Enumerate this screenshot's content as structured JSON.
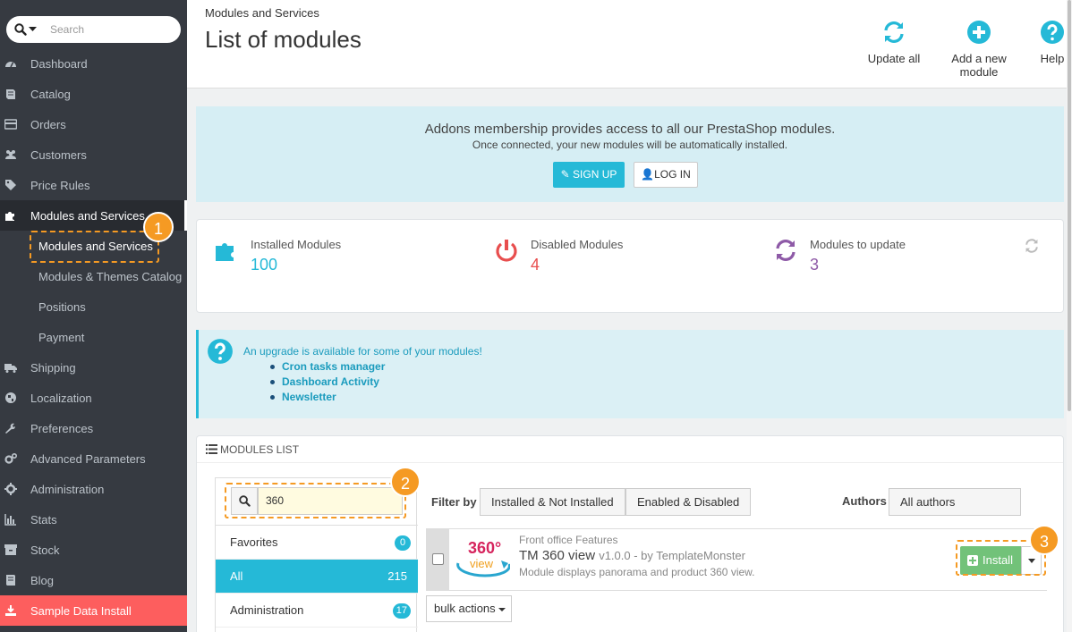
{
  "search": {
    "placeholder": "Search"
  },
  "nav": {
    "items": [
      {
        "label": "Dashboard",
        "icon": "dashboard-icon"
      },
      {
        "label": "Catalog",
        "icon": "book-icon"
      },
      {
        "label": "Orders",
        "icon": "credit-card-icon"
      },
      {
        "label": "Customers",
        "icon": "users-icon"
      },
      {
        "label": "Price Rules",
        "icon": "tags-icon"
      },
      {
        "label": "Modules and Services",
        "icon": "puzzle-icon"
      },
      {
        "label": "Shipping",
        "icon": "truck-icon"
      },
      {
        "label": "Localization",
        "icon": "globe-icon"
      },
      {
        "label": "Preferences",
        "icon": "wrench-icon"
      },
      {
        "label": "Advanced Parameters",
        "icon": "cogs-icon"
      },
      {
        "label": "Administration",
        "icon": "cog-icon"
      },
      {
        "label": "Stats",
        "icon": "bar-chart-icon"
      },
      {
        "label": "Stock",
        "icon": "archive-icon"
      },
      {
        "label": "Blog",
        "icon": "book-icon"
      },
      {
        "label": "Sample Data Install",
        "icon": "download-icon"
      }
    ],
    "submenu": [
      "Modules and Services",
      "Modules & Themes Catalog",
      "Positions",
      "Payment"
    ]
  },
  "callouts": [
    "1",
    "2",
    "3"
  ],
  "header": {
    "breadcrumb": "Modules and Services",
    "title": "List of modules",
    "toolbar": [
      {
        "label": "Update all",
        "icon": "refresh-icon"
      },
      {
        "label": "Add a new module",
        "icon": "plus-circle-icon"
      },
      {
        "label": "Help",
        "icon": "question-circle-icon"
      }
    ]
  },
  "addons": {
    "title": "Addons membership provides access to all our PrestaShop modules.",
    "subtitle": "Once connected, your new modules will be automatically installed.",
    "signup": "SIGN UP",
    "login": "LOG IN"
  },
  "stats": [
    {
      "label": "Installed Modules",
      "value": "100",
      "color": "#25b9d7",
      "icon": "puzzle-icon"
    },
    {
      "label": "Disabled Modules",
      "value": "4",
      "color": "#e84e4e",
      "icon": "power-icon"
    },
    {
      "label": "Modules to update",
      "value": "3",
      "color": "#8e5aa7",
      "icon": "refresh-icon"
    }
  ],
  "upgrade": {
    "text": "An upgrade is available for some of your modules!",
    "modules": [
      "Cron tasks manager",
      "Dashboard Activity",
      "Newsletter"
    ]
  },
  "modules_list": {
    "heading": "MODULES LIST",
    "filter_value": "360",
    "categories": [
      {
        "name": "Favorites",
        "count": "0"
      },
      {
        "name": "All",
        "count": "215"
      },
      {
        "name": "Administration",
        "count": "17"
      }
    ],
    "filter_by_label": "Filter by",
    "filter_install": "Installed & Not Installed",
    "filter_enabled": "Enabled & Disabled",
    "authors_label": "Authors",
    "authors_value": "All authors",
    "module": {
      "logo_text": "360°",
      "logo_sub": "view",
      "category": "Front office Features",
      "name": "TM 360 view",
      "version": "v1.0.0 - by TemplateMonster",
      "description": "Module displays panorama and product 360 view.",
      "install_label": "Install"
    },
    "bulk_actions": "bulk actions"
  },
  "colors": {
    "accent": "#25b9d7",
    "sidebar": "#363a41",
    "install": "#72c279",
    "callout": "#f59a23",
    "sample_data": "#fd5e5e"
  }
}
